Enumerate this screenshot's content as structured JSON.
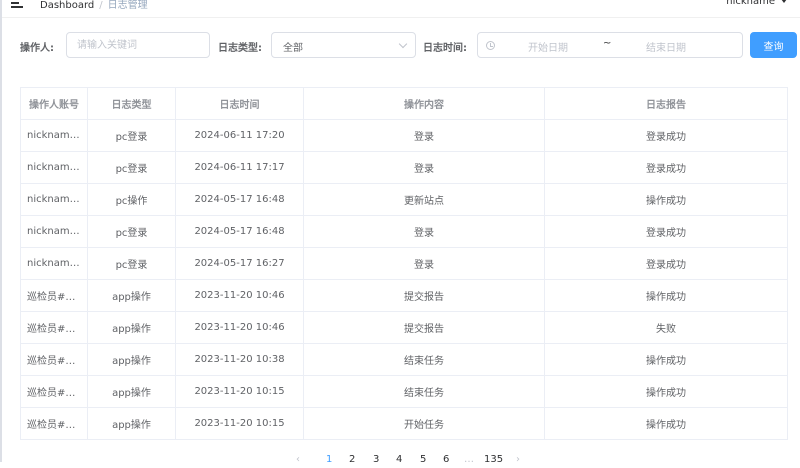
{
  "breadcrumb": {
    "home": "Dashboard",
    "separator": "/",
    "current": "日志管理"
  },
  "user": {
    "name": "nickname"
  },
  "filters": {
    "operator_label": "操作人:",
    "operator_placeholder": "请输入关键词",
    "type_label": "日志类型:",
    "type_value": "全部",
    "time_label": "日志时间:",
    "start_placeholder": "开始日期",
    "range_separator": "~",
    "end_placeholder": "结束日期",
    "query_button": "查询"
  },
  "table": {
    "columns": [
      "操作人账号",
      "日志类型",
      "日志时间",
      "操作内容",
      "日志报告"
    ],
    "rows": [
      [
        "nickname…",
        "pc登录",
        "2024-06-11 17:20",
        "登录",
        "登录成功"
      ],
      [
        "nickname…",
        "pc登录",
        "2024-06-11 17:17",
        "登录",
        "登录成功"
      ],
      [
        "nickname…",
        "pc操作",
        "2024-05-17 16:48",
        "更新站点",
        "操作成功"
      ],
      [
        "nickname…",
        "pc登录",
        "2024-05-17 16:48",
        "登录",
        "登录成功"
      ],
      [
        "nickname…",
        "pc登录",
        "2024-05-17 16:27",
        "登录",
        "登录成功"
      ],
      [
        "巡检员#9…",
        "app操作",
        "2023-11-20 10:46",
        "提交报告",
        "操作成功"
      ],
      [
        "巡检员#9…",
        "app操作",
        "2023-11-20 10:46",
        "提交报告",
        "失败"
      ],
      [
        "巡检员#9…",
        "app操作",
        "2023-11-20 10:38",
        "结束任务",
        "操作成功"
      ],
      [
        "巡检员#9…",
        "app操作",
        "2023-11-20 10:15",
        "结束任务",
        "操作成功"
      ],
      [
        "巡检员#9…",
        "app操作",
        "2023-11-20 10:15",
        "开始任务",
        "操作成功"
      ]
    ]
  },
  "pagination": {
    "prev": "‹",
    "pages": [
      "1",
      "2",
      "3",
      "4",
      "5",
      "6"
    ],
    "ellipsis": "…",
    "last": "135",
    "next": "›",
    "current": "1"
  },
  "colors": {
    "primary": "#409eff",
    "border": "#ebeef5",
    "text": "#606266",
    "header_text": "#909399"
  }
}
